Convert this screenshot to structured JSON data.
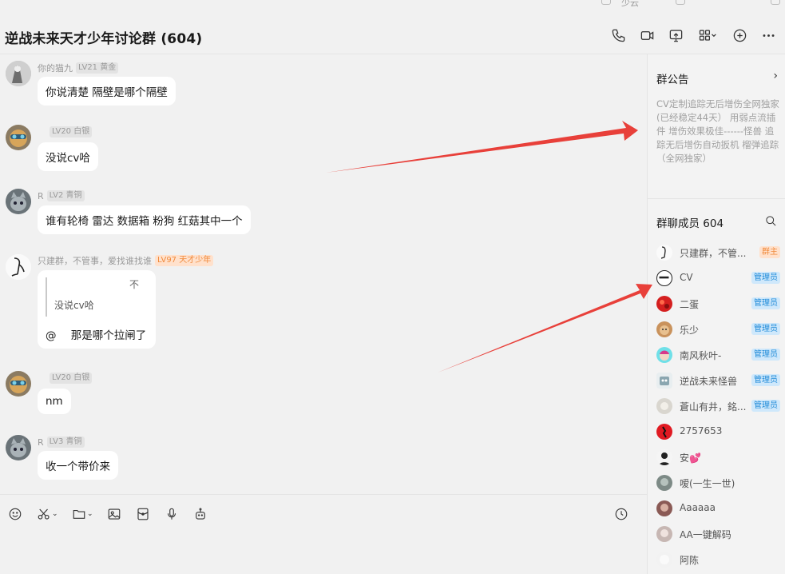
{
  "topbar": {
    "partial_label": "少云"
  },
  "header": {
    "title": "逆战未来天才少年讨论群 (604)"
  },
  "messages": [
    {
      "name": "你的猫九",
      "level": "LV21 黄金",
      "text": "你说清楚  隔壁是哪个隔壁"
    },
    {
      "name": "",
      "level": "LV20 白银",
      "text": "没说cv哈"
    },
    {
      "name": "R",
      "level": "LV2 青铜",
      "text": "谁有轮椅  雷达 数据箱 粉狗 红菇其中一个"
    },
    {
      "name": "只建群，不管事，爱找谁找谁",
      "level": "LV97 天才少年",
      "quote": "没说cv哈",
      "quote_arrow": "不",
      "reply_at": "@",
      "reply_text": "那是哪个拉闸了"
    },
    {
      "name": "",
      "level": "LV20 白银",
      "text": "nm"
    },
    {
      "name": "R",
      "level": "LV3 青铜",
      "text": "收一个带价来"
    }
  ],
  "sidebar": {
    "announcement_title": "群公告",
    "announcement_text": "CV定制追踪无后增伤全网独家 (已经稳定44天）  用弱点流插件 增伤效果极佳------怪兽 追踪无后增伤自动扳机 榴弹追踪（全网独家）",
    "members_title": "群聊成员 604",
    "members": [
      {
        "name": "只建群，不管...",
        "badge": "群主",
        "role": "owner"
      },
      {
        "name": "CV",
        "badge": "管理员",
        "role": "admin"
      },
      {
        "name": "二蛋",
        "badge": "管理员",
        "role": "admin"
      },
      {
        "name": "乐少",
        "badge": "管理员",
        "role": "admin"
      },
      {
        "name": "南风秋叶-",
        "badge": "管理员",
        "role": "admin"
      },
      {
        "name": "逆战未来怪兽",
        "badge": "管理员",
        "role": "admin"
      },
      {
        "name": "蒼山有井，銘...",
        "badge": "管理员",
        "role": "admin"
      },
      {
        "name": "2757653",
        "badge": "",
        "role": "member"
      },
      {
        "name": "安💕",
        "badge": "",
        "role": "member"
      },
      {
        "name": "嗳(一生一世)",
        "badge": "",
        "role": "member"
      },
      {
        "name": "Aaaaaa",
        "badge": "",
        "role": "member"
      },
      {
        "name": "AA一键解码",
        "badge": "",
        "role": "member"
      },
      {
        "name": "阿陈",
        "badge": "",
        "role": "member"
      }
    ]
  },
  "colors": {
    "arrow": "#e8403a",
    "admin_badge": "#1e8ad8",
    "owner_badge": "#f08a3c"
  },
  "icons": {
    "header": [
      "phone-icon",
      "video-icon",
      "screen-share-icon",
      "apps-icon",
      "add-icon",
      "more-icon"
    ],
    "toolbar": [
      "emoji-icon",
      "scissors-icon",
      "folder-icon",
      "image-icon",
      "red-packet-icon",
      "microphone-icon",
      "robot-icon",
      "history-icon"
    ]
  }
}
